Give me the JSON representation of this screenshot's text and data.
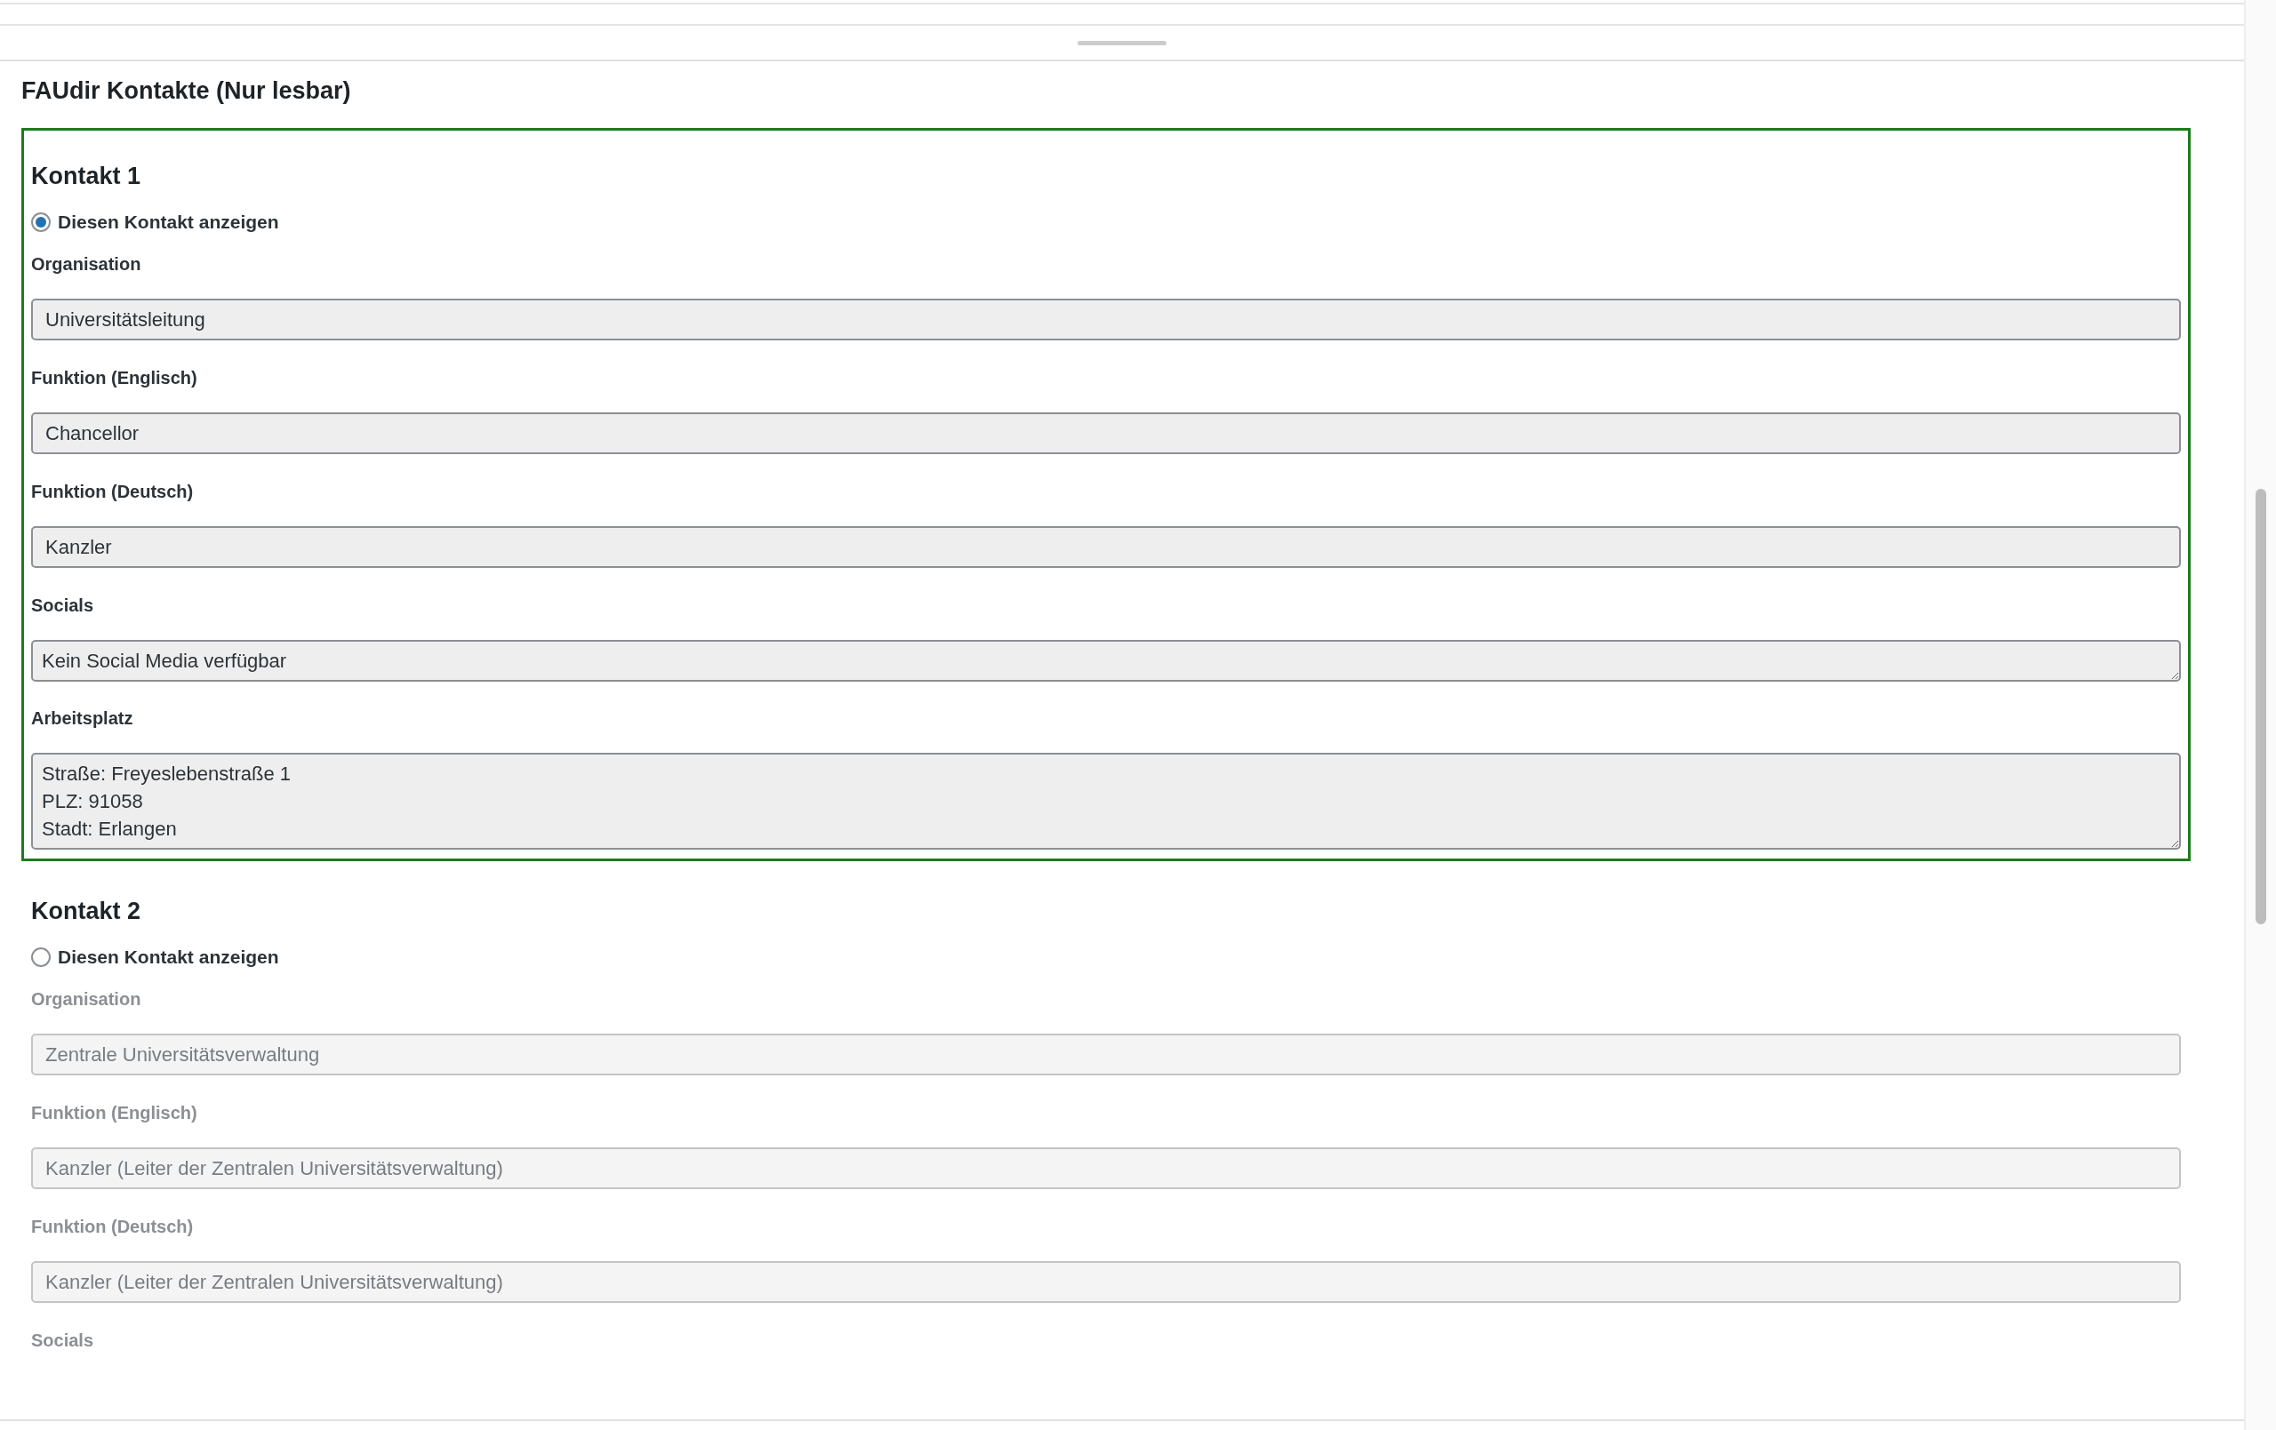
{
  "section_title": "FAUdir Kontakte (Nur lesbar)",
  "contacts": [
    {
      "heading": "Kontakt 1",
      "selected": true,
      "radio_label": "Diesen Kontakt anzeigen",
      "fields": [
        {
          "label": "Organisation",
          "kind": "input",
          "value": "Universitätsleitung"
        },
        {
          "label": "Funktion (Englisch)",
          "kind": "input",
          "value": "Chancellor"
        },
        {
          "label": "Funktion (Deutsch)",
          "kind": "input",
          "value": "Kanzler"
        },
        {
          "label": "Socials",
          "kind": "textarea",
          "value": "Kein Social Media verfügbar"
        },
        {
          "label": "Arbeitsplatz",
          "kind": "textarea",
          "value": "Straße: Freyeslebenstraße 1\nPLZ: 91058\nStadt: Erlangen"
        }
      ]
    },
    {
      "heading": "Kontakt 2",
      "selected": false,
      "radio_label": "Diesen Kontakt anzeigen",
      "fields": [
        {
          "label": "Organisation",
          "kind": "input",
          "value": "Zentrale Universitätsverwaltung"
        },
        {
          "label": "Funktion (Englisch)",
          "kind": "input",
          "value": "Kanzler (Leiter der Zentralen Universitätsverwaltung)"
        },
        {
          "label": "Funktion (Deutsch)",
          "kind": "input",
          "value": "Kanzler (Leiter der Zentralen Universitätsverwaltung)"
        },
        {
          "label": "Socials",
          "kind": "label"
        }
      ]
    }
  ]
}
